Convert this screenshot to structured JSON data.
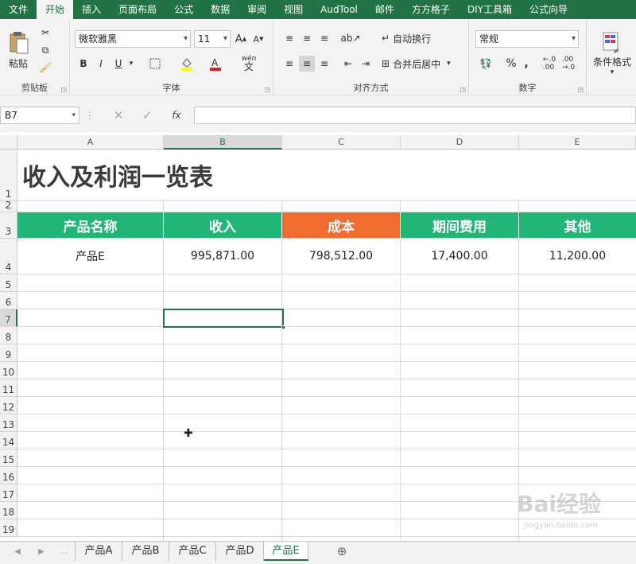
{
  "tabs": [
    "文件",
    "开始",
    "插入",
    "页面布局",
    "公式",
    "数据",
    "审阅",
    "视图",
    "AudTool",
    "邮件",
    "方方格子",
    "DIY工具箱",
    "公式向导"
  ],
  "active_tab_index": 1,
  "ribbon": {
    "clipboard": {
      "label": "剪贴板",
      "paste": "粘贴"
    },
    "font": {
      "label": "字体",
      "name": "微软雅黑",
      "size": "11",
      "bold": "B",
      "italic": "I",
      "underline": "U",
      "grow": "A",
      "shrink": "A",
      "phonetic": "wén",
      "phonetic_char": "文"
    },
    "alignment": {
      "label": "对齐方式",
      "wrap": "自动换行",
      "merge": "合并后居中"
    },
    "number": {
      "label": "数字",
      "format": "常规",
      "percent": "%",
      "comma": ","
    },
    "styles": {
      "label": "条件格式"
    }
  },
  "formula_bar": {
    "name_box": "B7",
    "fx": "fx",
    "value": ""
  },
  "columns": [
    "A",
    "B",
    "C",
    "D",
    "E"
  ],
  "rows": [
    "1",
    "2",
    "3",
    "4",
    "5",
    "6",
    "7",
    "8",
    "9",
    "10",
    "11",
    "12",
    "13",
    "14",
    "15",
    "16",
    "17",
    "18",
    "19"
  ],
  "sheet": {
    "title": "收入及利润一览表",
    "headers": [
      "产品名称",
      "收入",
      "成本",
      "期间费用",
      "其他"
    ],
    "data_row": [
      "产品E",
      "995,871.00",
      "798,512.00",
      "17,400.00",
      "11,200.00"
    ]
  },
  "colors": {
    "green": "#21b677",
    "orange": "#f26b2f",
    "excel": "#217346"
  },
  "sheet_tabs": [
    "产品A",
    "产品B",
    "产品C",
    "产品D",
    "产品E"
  ],
  "active_sheet_index": 4,
  "watermark": {
    "text": "Bai经验",
    "sub": "jingyan.baidu.com"
  }
}
